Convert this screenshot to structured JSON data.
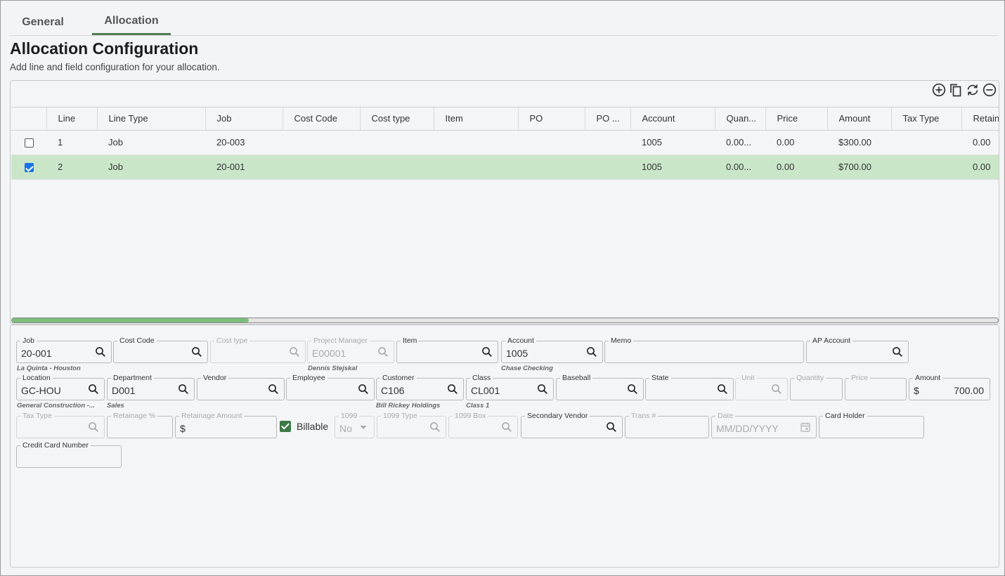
{
  "tabs": [
    {
      "label": "General",
      "active": false
    },
    {
      "label": "Allocation",
      "active": true
    }
  ],
  "page": {
    "title": "Allocation Configuration",
    "subtitle": "Add line and field configuration for your allocation."
  },
  "toolbar": {
    "icons": [
      "add-circle-icon",
      "copy-icon",
      "refresh-icon",
      "remove-circle-icon"
    ]
  },
  "grid": {
    "columns": [
      "Line",
      "Line Type",
      "Job",
      "Cost Code",
      "Cost type",
      "Item",
      "PO",
      "PO ...",
      "Account",
      "Quan...",
      "Price",
      "Amount",
      "Tax Type",
      "Retain"
    ],
    "rows": [
      {
        "selected": false,
        "cells": [
          "1",
          "Job",
          "20-003",
          "",
          "",
          "",
          "",
          "",
          "1005",
          "0.00...",
          "0.00",
          "$300.00",
          "",
          "0.00"
        ]
      },
      {
        "selected": true,
        "cells": [
          "2",
          "Job",
          "20-001",
          "",
          "",
          "",
          "",
          "",
          "1005",
          "0.00...",
          "0.00",
          "$700.00",
          "",
          "0.00"
        ]
      }
    ],
    "scroll_fraction": 0.24
  },
  "form": {
    "job": {
      "label": "Job",
      "value": "20-001",
      "sub": "La Quinta - Houston"
    },
    "cost_code": {
      "label": "Cost Code",
      "value": ""
    },
    "cost_type": {
      "label": "Cost type",
      "value": ""
    },
    "project_manager": {
      "label": "Project Manager",
      "value": "E00001",
      "sub": "Dennis Stejskal"
    },
    "item": {
      "label": "Item",
      "value": ""
    },
    "account": {
      "label": "Account",
      "value": "1005",
      "sub": "Chase Checking"
    },
    "memo": {
      "label": "Memo",
      "value": ""
    },
    "ap_account": {
      "label": "AP Account",
      "value": ""
    },
    "location": {
      "label": "Location",
      "value": "GC-HOU",
      "sub": "General Construction -..."
    },
    "department": {
      "label": "Department",
      "value": "D001",
      "sub": "Sales"
    },
    "vendor": {
      "label": "Vendor",
      "value": ""
    },
    "employee": {
      "label": "Employee",
      "value": ""
    },
    "customer": {
      "label": "Customer",
      "value": "C106",
      "sub": "Bill Rickey Holdings"
    },
    "class": {
      "label": "Class",
      "value": "CL001",
      "sub": "Class 1"
    },
    "baseball": {
      "label": "Baseball",
      "value": ""
    },
    "state": {
      "label": "State",
      "value": ""
    },
    "unit": {
      "label": "Unit",
      "value": ""
    },
    "quantity": {
      "label": "Quantity",
      "value": ""
    },
    "price": {
      "label": "Price",
      "value": ""
    },
    "amount": {
      "label": "Amount",
      "prefix": "$",
      "value": "700.00"
    },
    "tax_type": {
      "label": "Tax Type",
      "value": ""
    },
    "retainage_pct": {
      "label": "Retainage %",
      "value": ""
    },
    "retainage_amount": {
      "label": "Retainage Amount",
      "prefix": "$",
      "value": ""
    },
    "billable": {
      "label": "Billable",
      "checked": true
    },
    "f1099": {
      "label": "1099",
      "value": "No"
    },
    "f1099_type": {
      "label": "1099 Type",
      "value": ""
    },
    "f1099_box": {
      "label": "1099 Box",
      "value": ""
    },
    "secondary_vendor": {
      "label": "Secondary Vendor",
      "value": ""
    },
    "trans_no": {
      "label": "Trans #",
      "value": ""
    },
    "date": {
      "label": "Date",
      "placeholder": "MM/DD/YYYY"
    },
    "card_holder": {
      "label": "Card Holder",
      "value": ""
    },
    "credit_card_number": {
      "label": "Credit Card Number",
      "value": ""
    }
  },
  "colors": {
    "accent": "#4e7d52",
    "selected_row": "#c9e6c9",
    "checkbox_blue": "#1a73e8"
  }
}
